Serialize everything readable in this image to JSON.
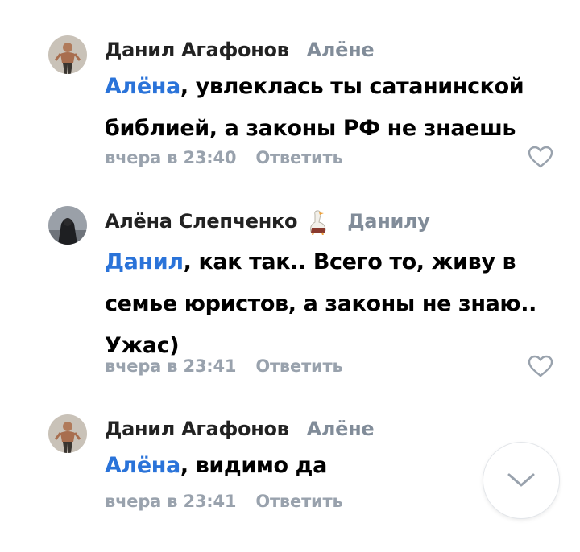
{
  "comments": [
    {
      "author": "Данил Агафонов",
      "reply_to": "Алёне",
      "mention": "Алёна",
      "text": ", увлеклась ты сатанинской библией, а законы РФ не знаешь",
      "time": "вчера в 23:40",
      "reply_label": "Ответить",
      "avatar_icon": "man-avatar",
      "like_icon": "heart-outline-icon"
    },
    {
      "author": "Алёна Слепченко",
      "reply_to": "Данилу",
      "mention": "Данил",
      "text": ", как так.. Всего то, живу в семье юристов, а законы не знаю.. Ужас)",
      "time": "вчера в 23:41",
      "reply_label": "Ответить",
      "avatar_icon": "woman-avatar",
      "badge_icon": "goose-emoji",
      "like_icon": "heart-outline-icon"
    },
    {
      "author": "Данил Агафонов",
      "reply_to": "Алёне",
      "mention": "Алёна",
      "text": ", видимо да",
      "time": "вчера в 23:41",
      "reply_label": "Ответить",
      "avatar_icon": "man-avatar"
    }
  ],
  "scroll_down_icon": "chevron-down-icon",
  "colors": {
    "mention": "#2a73d9",
    "secondary": "#818c99",
    "meta": "#99a2ad",
    "text": "#000000"
  }
}
